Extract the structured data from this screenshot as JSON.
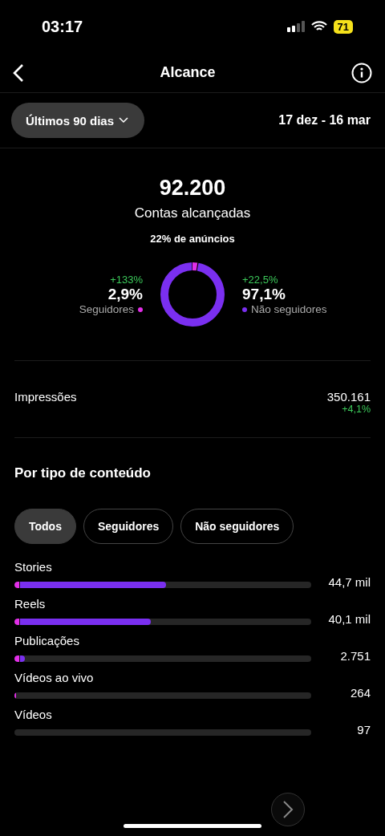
{
  "status_bar": {
    "time": "03:17",
    "battery": "71"
  },
  "header": {
    "title": "Alcance"
  },
  "period": {
    "label": "Últimos 90 dias",
    "range": "17 dez - 16 mar"
  },
  "summary": {
    "total": "92.200",
    "caption": "Contas alcançadas",
    "ads": "22% de anúncios"
  },
  "audience": [
    {
      "change": "+133%",
      "share": "2,9%",
      "label": "Seguidores",
      "color": "#e22ee8"
    },
    {
      "change": "+22,5%",
      "share": "97,1%",
      "label": "Não seguidores",
      "color": "#7a2ff0"
    }
  ],
  "impressions": {
    "label": "Impressões",
    "value": "350.161",
    "change": "+4,1%"
  },
  "content": {
    "title": "Por tipo de conteúdo",
    "tabs": [
      {
        "label": "Todos",
        "selected": true
      },
      {
        "label": "Seguidores",
        "selected": false
      },
      {
        "label": "Não seguidores",
        "selected": false
      }
    ],
    "rows": [
      {
        "label": "Stories",
        "value": "44,7 mil",
        "level": 0.51
      },
      {
        "label": "Reels",
        "value": "40,1 mil",
        "level": 0.46
      },
      {
        "label": "Publicações",
        "value": "2.751",
        "level": 0.036
      },
      {
        "label": "Vídeos ao vivo",
        "value": "264",
        "level": 0.006
      },
      {
        "label": "Vídeos",
        "value": "97"
      }
    ]
  }
}
